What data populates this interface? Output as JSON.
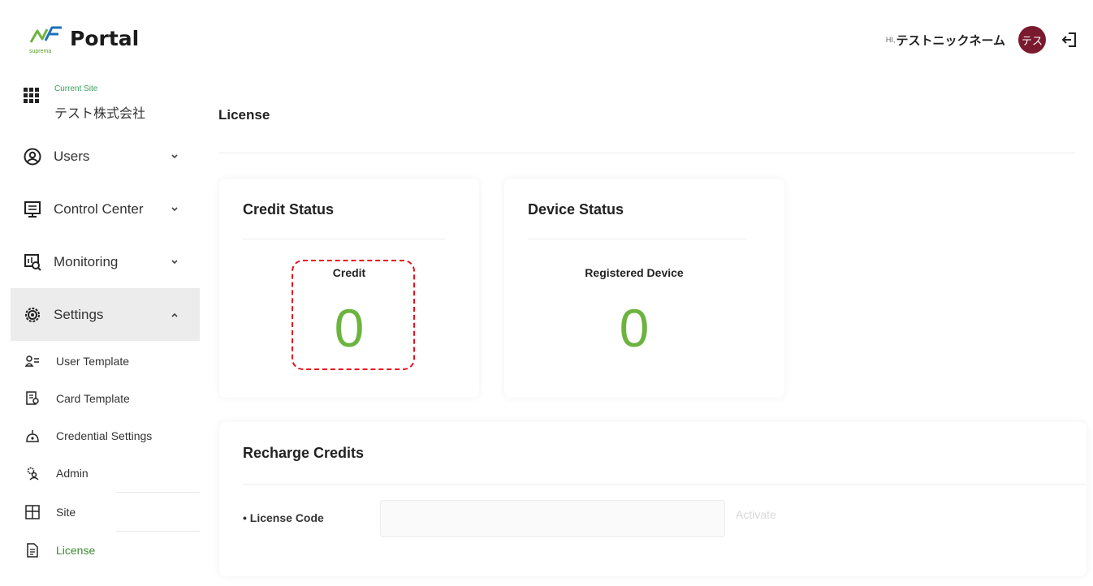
{
  "header": {
    "logo_text": "Portal",
    "logo_sub": "suprema",
    "greeting": "HI,",
    "nickname": "テストニックネーム",
    "avatar_text": "テス",
    "avatar_color": "#7a1a2e"
  },
  "sidebar": {
    "site_label": "Current Site",
    "site_name": "テスト株式会社",
    "nav": [
      {
        "label": "Users",
        "icon": "user-circle-icon",
        "expanded": false
      },
      {
        "label": "Control Center",
        "icon": "monitor-icon",
        "expanded": false
      },
      {
        "label": "Monitoring",
        "icon": "monitoring-icon",
        "expanded": false
      },
      {
        "label": "Settings",
        "icon": "gear-icon",
        "expanded": true
      }
    ],
    "sub": [
      {
        "label": "User Template",
        "icon": "user-template-icon"
      },
      {
        "label": "Card Template",
        "icon": "card-template-icon"
      },
      {
        "label": "Credential Settings",
        "icon": "credential-icon"
      },
      {
        "label": "Admin",
        "icon": "admin-icon"
      },
      {
        "label": "Site",
        "icon": "site-icon"
      },
      {
        "label": "License",
        "icon": "license-icon"
      }
    ]
  },
  "main": {
    "title": "License",
    "credit": {
      "title": "Credit Status",
      "label": "Credit",
      "value": "0"
    },
    "device": {
      "title": "Device Status",
      "label": "Registered Device",
      "value": "0"
    },
    "recharge": {
      "title": "Recharge Credits",
      "field_label": "• License Code",
      "field_value": "",
      "button": "Activate"
    }
  },
  "colors": {
    "accent": "#6cb33f",
    "active_text": "#3a8a2e",
    "highlight": "#e3121d"
  }
}
